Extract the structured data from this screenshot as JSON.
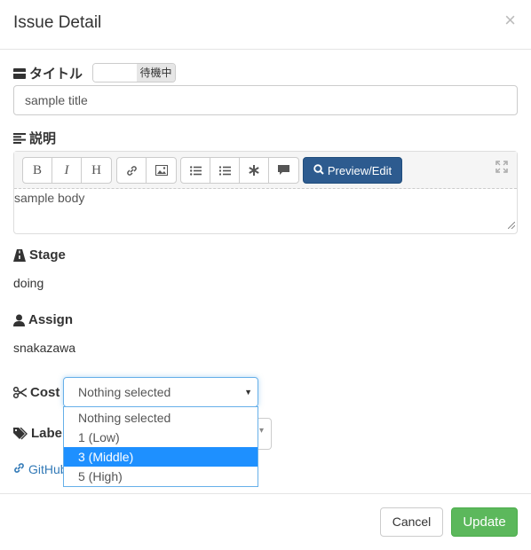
{
  "modal": {
    "title": "Issue Detail",
    "close": "×"
  },
  "title_field": {
    "label": "タイトル",
    "toggle_state": "待機中",
    "value": "sample title"
  },
  "description": {
    "label": "説明",
    "toolbar": {
      "bold": "B",
      "italic": "I",
      "heading": "H",
      "preview_label": "Preview/Edit"
    },
    "body": "sample body"
  },
  "stage": {
    "label": "Stage",
    "value": "doing"
  },
  "assign": {
    "label": "Assign",
    "value": "snakazawa"
  },
  "cost": {
    "label": "Cost",
    "selected": "Nothing selected",
    "options": [
      "Nothing selected",
      "1 (Low)",
      "3 (Middle)",
      "5 (High)"
    ],
    "highlighted_option": "3 (Middle)"
  },
  "labels": {
    "label": "Label"
  },
  "github_link": {
    "text": "GitHub"
  },
  "footer": {
    "cancel": "Cancel",
    "update": "Update"
  },
  "colors": {
    "primary": "#2d5b8f",
    "success": "#5cb85c",
    "highlight": "#1e90ff",
    "link": "#337ab7"
  }
}
